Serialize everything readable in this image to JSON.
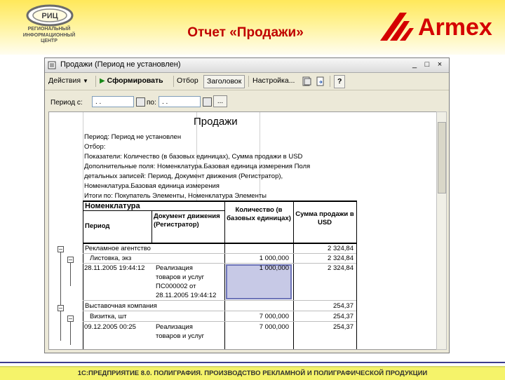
{
  "slide": {
    "title": "Отчет «Продажи»",
    "logo_left_lines": "РЕГИОНАЛЬНЫЙ\nИНФОРМАЦИОННЫЙ\nЦЕНТР",
    "logo_left_abbrev": "РИЦ",
    "logo_right": "Armex",
    "footer": "1С:ПРЕДПРИЯТИЕ 8.0. ПОЛИГРАФИЯ. ПРОИЗВОДСТВО РЕКЛАМНОЙ И ПОЛИГРАФИЧЕСКОЙ ПРОДУКЦИИ",
    "colors": {
      "title": "#c00000",
      "header_bg": "#fff39a",
      "footer_bg": "#f5f36a"
    }
  },
  "window": {
    "title": "Продажи (Период не установлен)",
    "controls": [
      "_",
      "□",
      "×"
    ]
  },
  "toolbar": {
    "actions": "Действия",
    "generate": "Сформировать",
    "filter": "Отбор",
    "header": "Заголовок",
    "settings": "Настройка...",
    "help": "?"
  },
  "period": {
    "from_label": "Период с:",
    "from_value": ". .",
    "to_label": "по:",
    "to_value": ". .",
    "ellipsis": "..."
  },
  "report": {
    "title": "Продажи",
    "params": [
      "Период: Период не установлен",
      "Отбор:",
      "Показатели: Количество (в базовых единицах), Сумма продажи в USD",
      "Дополнительные поля: Номенклатура.Базовая единица измерения Поля",
      "детальных записей: Период, Документ движения (Регистратор),",
      "Номенклатура.Базовая единица измерения",
      "Итоги по: Покупатель Элементы, Номенклатура Элементы"
    ],
    "columns": {
      "nomenclature": "Номенклатура",
      "period": "Период",
      "document": "Документ движения (Регистратор)",
      "quantity": "Количество (в базовых единицах)",
      "sum": "Сумма продажи в USD"
    },
    "rows": [
      {
        "name": "Рекламное агентство",
        "qty": "",
        "sum": "2 324,84"
      },
      {
        "name": "Листовка, экз",
        "qty": "1 000,000",
        "sum": "2 324,84"
      },
      {
        "date": "28.11.2005 19:44:12",
        "doc": "Реализация товаров и услуг ПС000002 от 28.11.2005 19:44:12",
        "qty": "1 000,000",
        "sum": "2 324,84"
      },
      {
        "name": "Выставочная компания",
        "qty": "",
        "sum": "254,37"
      },
      {
        "name": "Визитка, шт",
        "qty": "7 000,000",
        "sum": "254,37"
      },
      {
        "date": "09.12.2005 00:25",
        "doc": "Реализация товаров и услуг",
        "qty": "7 000,000",
        "sum": "254,37"
      }
    ],
    "doc_lines": [
      "Реализация",
      "товаров и услуг",
      "ПС000002 от",
      "28.11.2005 19:44:12"
    ],
    "doc_lines2": [
      "Реализация",
      "товаров и услуг"
    ]
  }
}
